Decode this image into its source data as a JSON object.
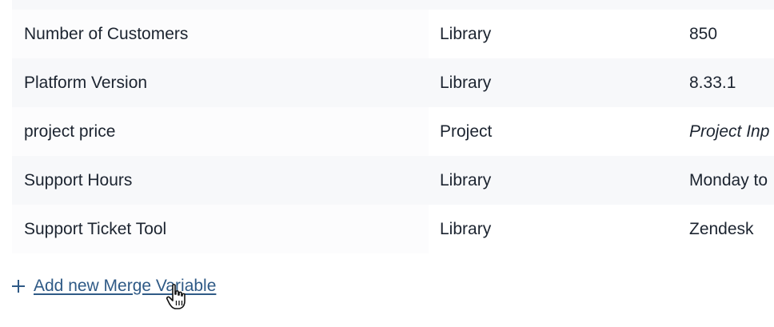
{
  "rows": [
    {
      "name": "",
      "type": "",
      "value": "",
      "italic": false
    },
    {
      "name": "Number of Customers",
      "type": "Library",
      "value": "850",
      "italic": false
    },
    {
      "name": "Platform Version",
      "type": "Library",
      "value": "8.33.1",
      "italic": false
    },
    {
      "name": "project price",
      "type": "Project",
      "value": "Project Inp",
      "italic": true
    },
    {
      "name": "Support Hours",
      "type": "Library",
      "value": "Monday to",
      "italic": false
    },
    {
      "name": "Support Ticket Tool",
      "type": "Library",
      "value": "Zendesk",
      "italic": false
    }
  ],
  "add_action": {
    "label": "Add new Merge Variable",
    "icon": "plus-icon"
  },
  "colors": {
    "link": "#2f5a86",
    "text": "#1c2430",
    "row_alt": "#f7f8fa"
  }
}
